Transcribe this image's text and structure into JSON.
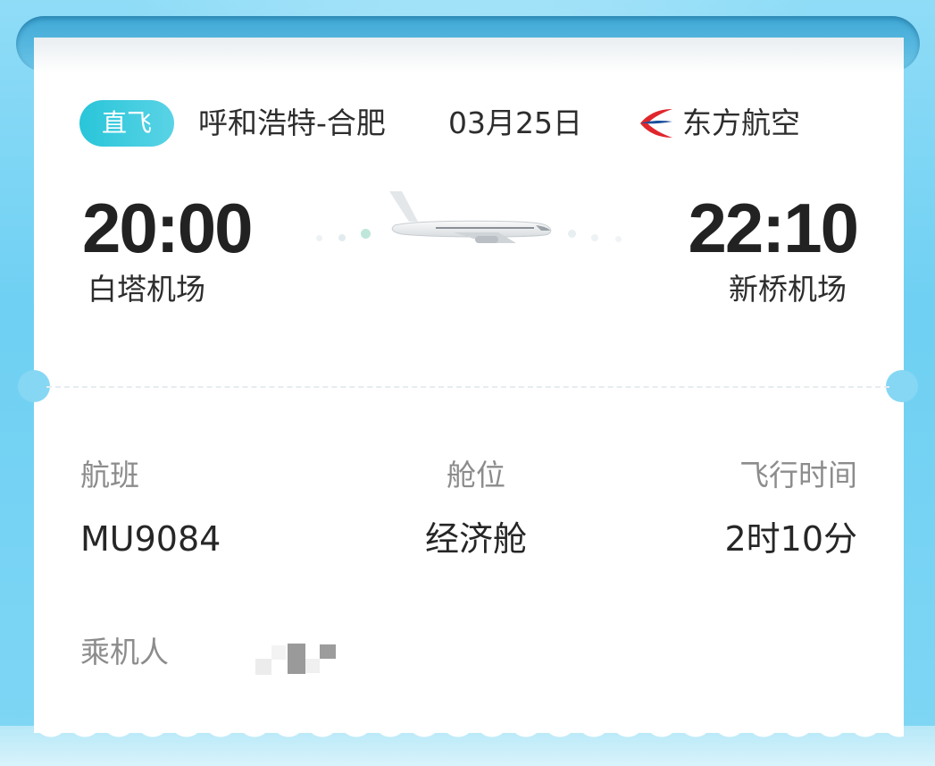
{
  "ticket": {
    "badge": "直飞",
    "route": "呼和浩特-合肥",
    "date": "03月25日",
    "airline": "东方航空"
  },
  "departure": {
    "time": "20:00",
    "airport": "白塔机场"
  },
  "arrival": {
    "time": "22:10",
    "airport": "新桥机场"
  },
  "details": {
    "flight_label": "航班",
    "flight_value": "MU9084",
    "cabin_label": "舱位",
    "cabin_value": "经济舱",
    "duration_label": "飞行时间",
    "duration_value": "2时10分"
  },
  "passenger": {
    "label": "乘机人"
  },
  "colors": {
    "badge": "#29c5d9",
    "background": "#7fd6f4",
    "logo_red": "#e0262c",
    "logo_blue": "#1b4f9c"
  },
  "icons": {
    "airline_logo": "china-eastern-logo-icon",
    "plane": "airplane-icon"
  }
}
